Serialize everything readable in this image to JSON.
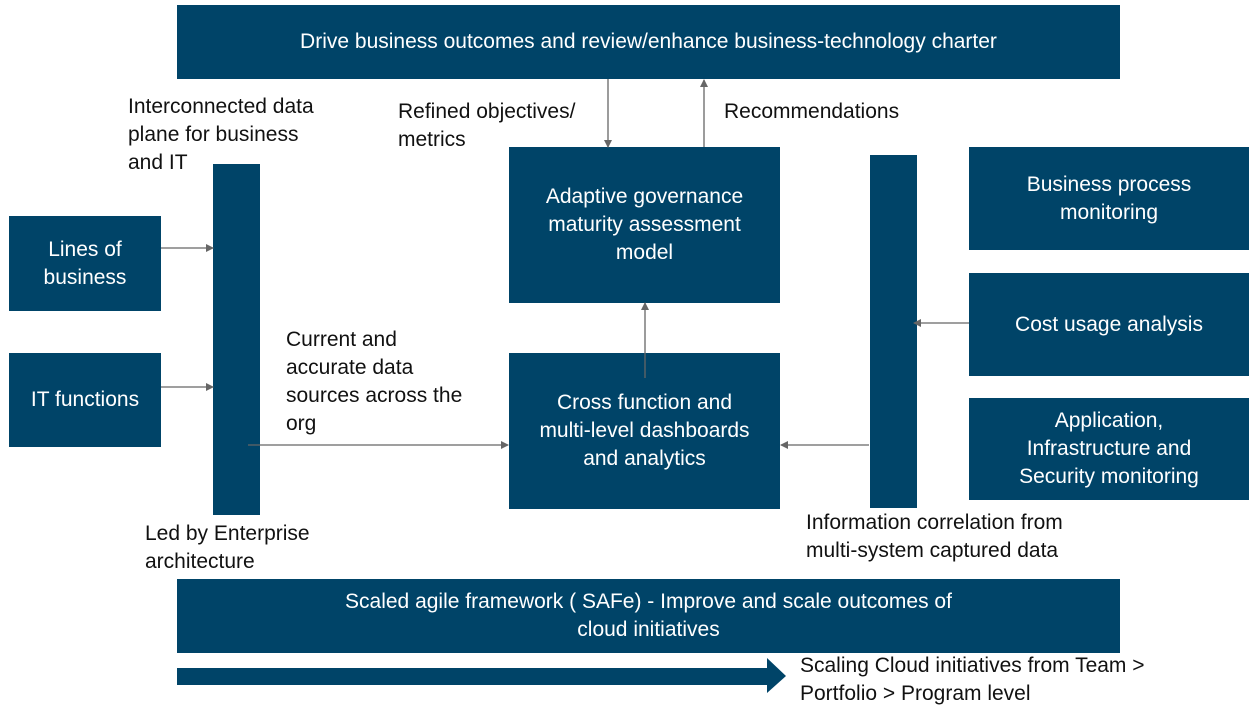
{
  "colors": {
    "box_fill": "#004468",
    "box_text": "#ffffff",
    "connector": "#666666",
    "label_text": "#111111"
  },
  "top_banner": {
    "text": "Drive business outcomes and review/enhance business-technology charter"
  },
  "left_column": {
    "data_plane_label": "Interconnected data\nplane for  business\nand IT",
    "lines_of_business": "Lines of\nbusiness",
    "it_functions": "IT functions",
    "led_by_label": "Led by Enterprise\narchitecture",
    "data_sources_label": "Current and\naccurate data\nsources across the\norg"
  },
  "center": {
    "refined_label": "Refined objectives/\nmetrics",
    "recommendations_label": "Recommendations",
    "assessment_model": "Adaptive governance\nmaturity assessment\nmodel",
    "dashboards": "Cross function and\nmulti-level dashboards\nand analytics"
  },
  "right_column": {
    "business_process": "Business process\nmonitoring",
    "cost_usage": "Cost usage analysis",
    "application_monitoring": "Application,\nInfrastructure and\nSecurity monitoring",
    "correlation_label": "Information correlation from\nmulti-system captured data"
  },
  "bottom": {
    "safe_banner": "Scaled agile framework ( SAFe) -  Improve and scale outcomes of\ncloud initiatives",
    "scaling_label": "Scaling Cloud initiatives from Team >\nPortfolio > Program level"
  }
}
